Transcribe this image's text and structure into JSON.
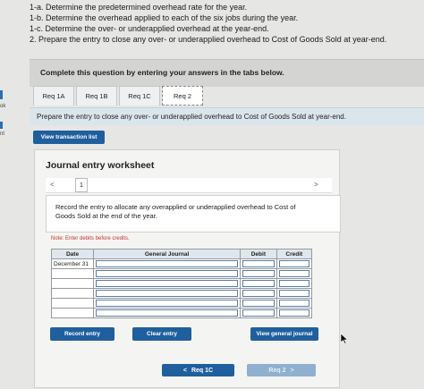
{
  "instructions": [
    "1-a. Determine the predetermined overhead rate for the year.",
    "1-b. Determine the overhead applied to each of the six jobs during the year.",
    "1-c. Determine the over- or underapplied overhead at the year-end.",
    "2. Prepare the entry to close any over- or underapplied overhead to Cost of Goods Sold at year-end."
  ],
  "edge_labels": [
    "ok",
    "nt"
  ],
  "panel_text": "Complete this question by entering your answers in the tabs below.",
  "tabs": [
    {
      "label": "Req 1A"
    },
    {
      "label": "Req 1B"
    },
    {
      "label": "Req 1C"
    },
    {
      "label": "Req 2"
    }
  ],
  "active_tab": "Req 2",
  "prompt": "Prepare the entry to close any over- or underapplied overhead to Cost of Goods Sold at year-end.",
  "view_transaction_list": "View transaction list",
  "worksheet": {
    "title": "Journal entry worksheet",
    "page": "1",
    "prev_arrow": "<",
    "next_arrow": ">",
    "description": "Record the entry to allocate any overapplied or underapplied overhead to Cost of Goods Sold at the end of the year.",
    "note": "Note: Enter debits before credits.",
    "columns": [
      "Date",
      "General Journal",
      "Debit",
      "Credit"
    ],
    "first_date": "December 31"
  },
  "buttons": {
    "record": "Record entry",
    "clear": "Clear entry",
    "view_journal": "View general journal"
  },
  "footer": {
    "prev": "Req 1C",
    "next": "Req 2",
    "prev_arrow": "<",
    "next_arrow": ">"
  }
}
